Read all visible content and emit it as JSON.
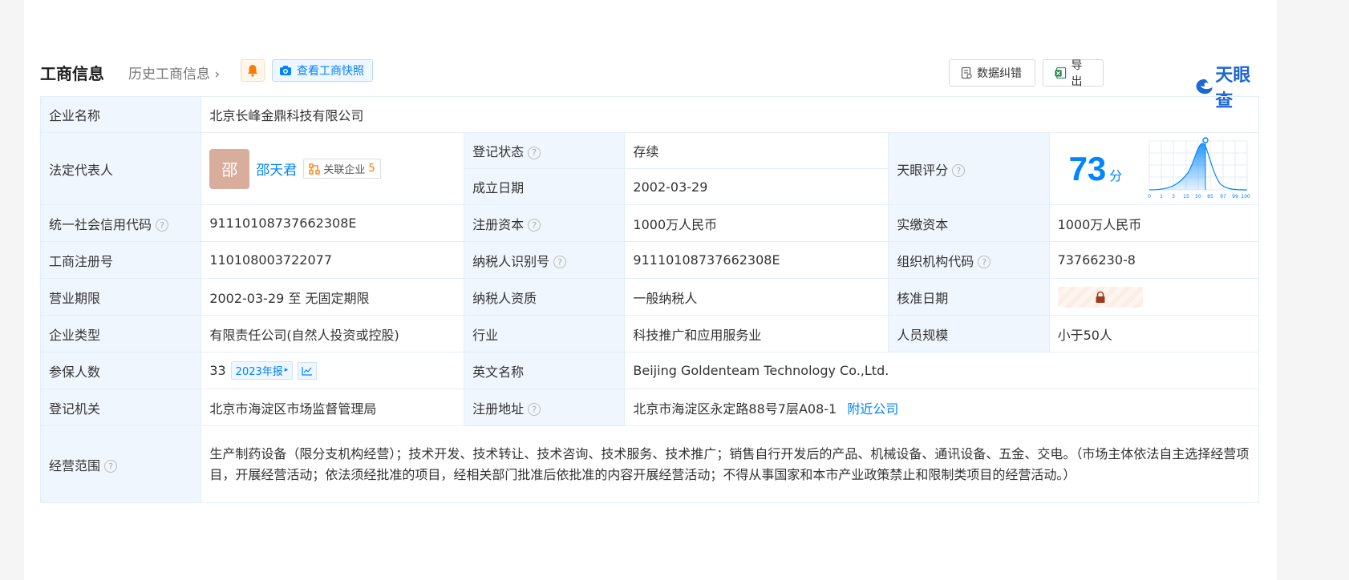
{
  "header": {
    "title": "工商信息",
    "history_label": "历史工商信息",
    "snapshot_label": "查看工商快照",
    "correct_label": "数据纠错",
    "export_label": "导出",
    "logo_text": "天眼查"
  },
  "labels": {
    "company_name": "企业名称",
    "legal_rep": "法定代表人",
    "reg_status": "登记状态",
    "found_date": "成立日期",
    "tianyan_score": "天眼评分",
    "credit_code": "统一社会信用代码",
    "reg_capital": "注册资本",
    "paid_capital": "实缴资本",
    "reg_no": "工商注册号",
    "taxpayer_id": "纳税人识别号",
    "org_code": "组织机构代码",
    "biz_term": "营业期限",
    "taxpayer_qual": "纳税人资质",
    "approve_date": "核准日期",
    "company_type": "企业类型",
    "industry": "行业",
    "staff_size": "人员规模",
    "insured": "参保人数",
    "english_name": "英文名称",
    "reg_authority": "登记机关",
    "reg_address": "注册地址",
    "biz_scope": "经营范围"
  },
  "values": {
    "company_name": "北京长峰金鼎科技有限公司",
    "avatar_char": "邵",
    "legal_rep_name": "邵天君",
    "related_label": "关联企业",
    "related_count": "5",
    "reg_status": "存续",
    "found_date": "2002-03-29",
    "score": "73",
    "score_unit": "分",
    "credit_code": "91110108737662308E",
    "reg_capital": "1000万人民币",
    "paid_capital": "1000万人民币",
    "reg_no": "110108003722077",
    "taxpayer_id": "91110108737662308E",
    "org_code": "73766230-8",
    "biz_term": "2002-03-29 至 无固定期限",
    "taxpayer_qual": "一般纳税人",
    "company_type": "有限责任公司(自然人投资或控股)",
    "industry": "科技推广和应用服务业",
    "staff_size": "小于50人",
    "insured": "33",
    "annual_report": "2023年报",
    "english_name": "Beijing Goldenteam Technology Co.,Ltd.",
    "reg_authority": "北京市海淀区市场监督管理局",
    "reg_address": "北京市海淀区永定路88号7层A08-1",
    "nearby_label": "附近公司",
    "biz_scope": "生产制药设备（限分支机构经营）；技术开发、技术转让、技术咨询、技术服务、技术推广；销售自行开发后的产品、机械设备、通讯设备、五金、交电。（市场主体依法自主选择经营项目，开展经营活动；依法须经批准的项目，经相关部门批准后依批准的内容开展经营活动；不得从事国家和本市产业政策禁止和限制类项目的经营活动。）"
  },
  "score_chart": {
    "x_ticks": [
      "0",
      "1",
      "3",
      "15",
      "50",
      "85",
      "97",
      "99",
      "100"
    ]
  },
  "colors": {
    "accent": "#0084ff",
    "status_green": "#28a745",
    "label_bg": "#f0f6fd"
  }
}
